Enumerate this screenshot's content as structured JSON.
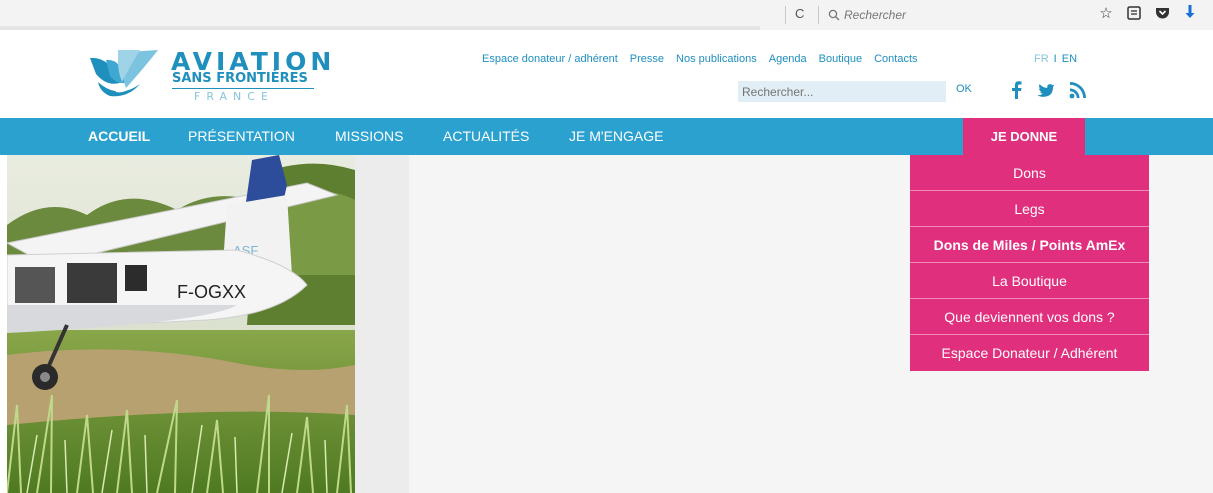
{
  "browser": {
    "reload_glyph": "C",
    "search_placeholder": "Rechercher",
    "icons": [
      "star-icon",
      "reading-list-icon",
      "pocket-icon",
      "download-icon"
    ]
  },
  "logo": {
    "title": "AVIATION",
    "subtitle": "SANS FRONTIÈRES",
    "country": "FRANCE"
  },
  "top_links": [
    "Espace donateur / adhérent",
    "Presse",
    "Nos publications",
    "Agenda",
    "Boutique",
    "Contacts"
  ],
  "lang": {
    "fr": "FR",
    "separator": "I",
    "en": "EN"
  },
  "search": {
    "placeholder": "Rechercher...",
    "button": "OK"
  },
  "social": [
    "facebook-icon",
    "twitter-icon",
    "rss-icon"
  ],
  "nav": {
    "items": [
      "ACCUEIL",
      "PRÉSENTATION",
      "MISSIONS",
      "ACTUALITÉS",
      "JE M'ENGAGE"
    ],
    "donate": "JE DONNE"
  },
  "dropdown": [
    "Dons",
    "Legs",
    "Dons de Miles / Points AmEx",
    "La Boutique",
    "Que deviennent vos dons ?",
    "Espace Donateur / Adhérent"
  ],
  "hero": {
    "registration": "F-OGXX",
    "tail_logo": "ASF"
  },
  "colors": {
    "brand_blue": "#2ba1cf",
    "donate_pink": "#e02f7d",
    "logo_blue": "#1f8fbe"
  }
}
